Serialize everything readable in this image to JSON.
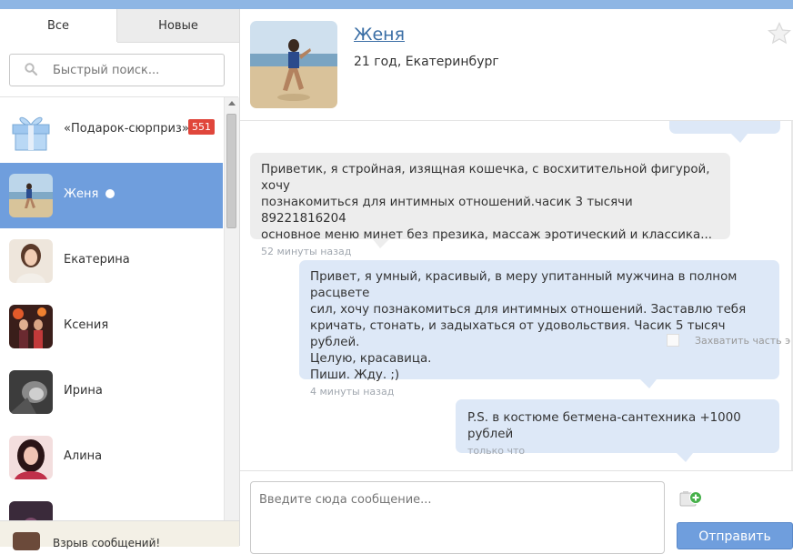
{
  "tabs": {
    "all": "Все",
    "new": "Новые"
  },
  "search": {
    "placeholder": "Быстрый поиск..."
  },
  "contacts": [
    {
      "name": "«Подарок-сюрприз»",
      "badge": "551",
      "icon": "gift-icon"
    },
    {
      "name": "Женя",
      "online": true,
      "selected": true
    },
    {
      "name": "Екатерина"
    },
    {
      "name": "Ксения"
    },
    {
      "name": "Ирина"
    },
    {
      "name": "Алина"
    }
  ],
  "bottom_strip": {
    "text": "Взрыв сообщений!"
  },
  "profile": {
    "name": "Женя",
    "info": "21 год, Екатеринбург"
  },
  "messages": [
    {
      "text": "Приветик, я стройная, изящная кошечка, с восхитительной фигурой, хочу\nпознакомиться для интимных отношений.часик 3 тысячи 89221816204\nосновное меню минет без презика, массаж эротический и классика...",
      "time": "52 минуты назад",
      "direction": "in"
    },
    {
      "text": "Привет, я умный, красивый, в меру упитанный мужчина в полном расцвете\nсил, хочу познакомиться для интимных отношений. Заставлю тебя\nкричать, стонать, и задыхаться от удовольствия. Часик 5 тысяч рублей.\nЦелую, красавица.\nПиши. Жду. ;)",
      "time": "4 минуты назад",
      "direction": "out"
    },
    {
      "text": "P.S. в костюме бетмена-сантехника +1000 рублей",
      "time": "только что",
      "direction": "out"
    }
  ],
  "overlay": {
    "label": "Захватить часть экр"
  },
  "composer": {
    "placeholder": "Введите сюда сообщение...",
    "send_label": "Отправить"
  },
  "colors": {
    "accent": "#6f9edd",
    "badge": "#e0463b",
    "incoming": "#ededed",
    "outgoing": "#dde8f7",
    "link": "#3a6ea5"
  }
}
